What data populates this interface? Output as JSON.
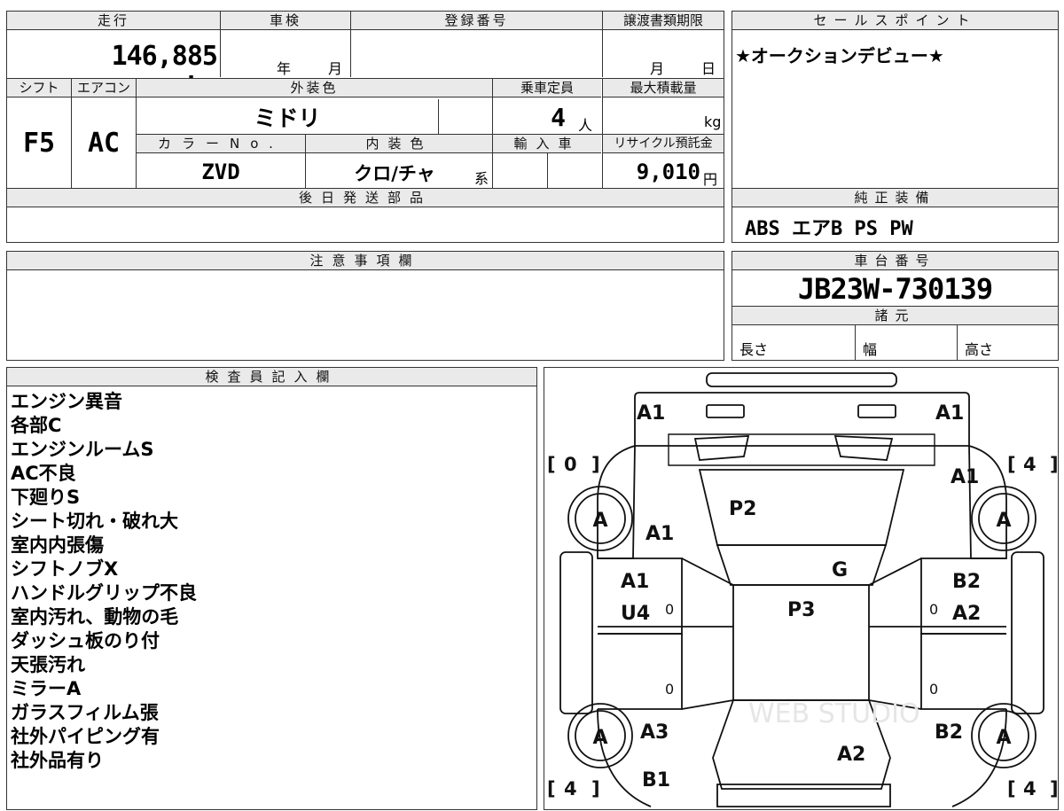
{
  "mileage": {
    "label": "走行",
    "value": "146,885 km"
  },
  "inspection": {
    "label": "車検",
    "year_unit": "年",
    "month_unit": "月"
  },
  "registration": {
    "label": "登録番号",
    "value": ""
  },
  "transfer_deadline": {
    "label": "譲渡書類期限",
    "month_unit": "月",
    "day_unit": "日"
  },
  "shift": {
    "label": "シフト",
    "value": "F5"
  },
  "aircon": {
    "label": "エアコン",
    "value": "AC"
  },
  "exterior_color": {
    "label": "外装色",
    "value": "ミドリ"
  },
  "capacity": {
    "label": "乗車定員",
    "value": "4",
    "unit": "人"
  },
  "max_load": {
    "label": "最大積載量",
    "value": "",
    "unit": "kg"
  },
  "color_no": {
    "label": "カラーNo.",
    "value": "ZVD"
  },
  "interior_color": {
    "label": "内装色",
    "value": "クロ/チャ",
    "suffix": "系"
  },
  "import_car": {
    "label": "輸入車"
  },
  "recycle_fee": {
    "label": "リサイクル預託金",
    "value": "9,010",
    "unit": "円"
  },
  "later_parts": {
    "label": "後日発送部品",
    "value": ""
  },
  "sales_point": {
    "label": "セールスポイント",
    "value": "★オークションデビュー★"
  },
  "genuine_equipment": {
    "label": "純正装備",
    "value": "ABS エアB PS PW"
  },
  "caution": {
    "label": "注意事項欄",
    "value": ""
  },
  "chassis_number": {
    "label": "車台番号",
    "value": "JB23W-730139"
  },
  "specs": {
    "label": "諸元",
    "length": "長さ",
    "width": "幅",
    "height": "高さ"
  },
  "inspector_notes": {
    "label": "検査員記入欄",
    "lines": [
      "エンジン異音",
      "各部C",
      "エンジンルームS",
      "AC不良",
      "下廻りS",
      "シート切れ・破れ大",
      "室内内張傷",
      "シフトノブX",
      "ハンドルグリップ不良",
      "室内汚れ、動物の毛",
      "ダッシュ板のり付",
      "天張汚れ",
      "ミラーA",
      "ガラスフィルム張",
      "社外パイピング有",
      "社外品有り"
    ]
  },
  "diagram": {
    "marks": {
      "front_left": "A1",
      "front_right": "A1",
      "right_front_fender": "A1",
      "left_front_fender": "A1",
      "hood": "P2",
      "glass": "G",
      "roof": "P3",
      "left_front_door_1": "A1",
      "left_front_door_2": "U4",
      "right_front_door_1": "B2",
      "right_front_door_2": "A2",
      "left_rear": "A3",
      "right_rear": "B2",
      "rear": "A2",
      "rear_left_bottom": "B1"
    },
    "tire_label": "A",
    "tread": {
      "front_left": "0",
      "front_right": "4",
      "rear_left": "4",
      "rear_right": "4"
    },
    "door_zero": "0",
    "watermark": "WEB STUDIO"
  }
}
